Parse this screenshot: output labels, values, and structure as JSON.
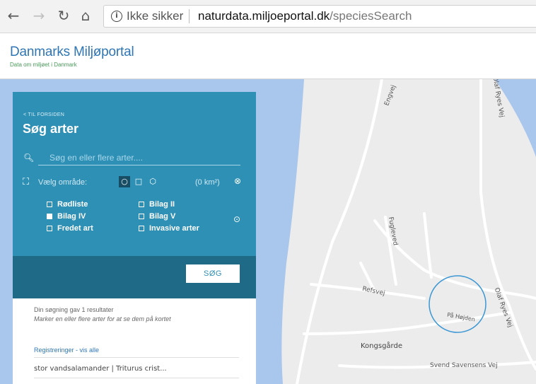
{
  "browser": {
    "back_icon": "arrow-left-icon",
    "forward_icon": "arrow-right-icon",
    "reload_icon": "reload-icon",
    "home_icon": "home-icon",
    "security_text": "Ikke sikker",
    "url_host": "naturdata.miljoeportal.dk",
    "url_path": "/speciesSearch"
  },
  "site": {
    "title": "Danmarks Miljøportal",
    "subtitle": "Data om miljøet i Danmark"
  },
  "panel": {
    "back_link": "< TIL FORSIDEN",
    "title": "Søg arter",
    "search_placeholder": "Søg en eller flere arter....",
    "area_label": "Vælg område:",
    "area_km": "(0 km²)",
    "filters": [
      {
        "label": "Rødliste",
        "checked": false
      },
      {
        "label": "Bilag II",
        "checked": false
      },
      {
        "label": "Bilag IV",
        "checked": true
      },
      {
        "label": "Bilag V",
        "checked": false
      },
      {
        "label": "Fredet art",
        "checked": false
      },
      {
        "label": "Invasive arter",
        "checked": false
      }
    ],
    "search_button": "SØG",
    "result_count": "Din søgning gav 1 resultater",
    "result_hint": "Marker en eller flere arter for at se dem på kortet",
    "registrations_link": "Registreringer - vis alle",
    "species_item": "stor vandsalamander | Triturus crist..."
  },
  "map": {
    "labels": [
      "Fugleved",
      "Refsvej",
      "Kongsgårde",
      "Svend Savensens Vej",
      "På Højden",
      "Olaf Ryes Vej",
      "Engvej"
    ],
    "colors": {
      "sea": "#a9c6ec",
      "land": "#ececec",
      "road": "#ffffff",
      "panel": "#2f90b5",
      "panel_dark": "#1f6a86"
    }
  }
}
